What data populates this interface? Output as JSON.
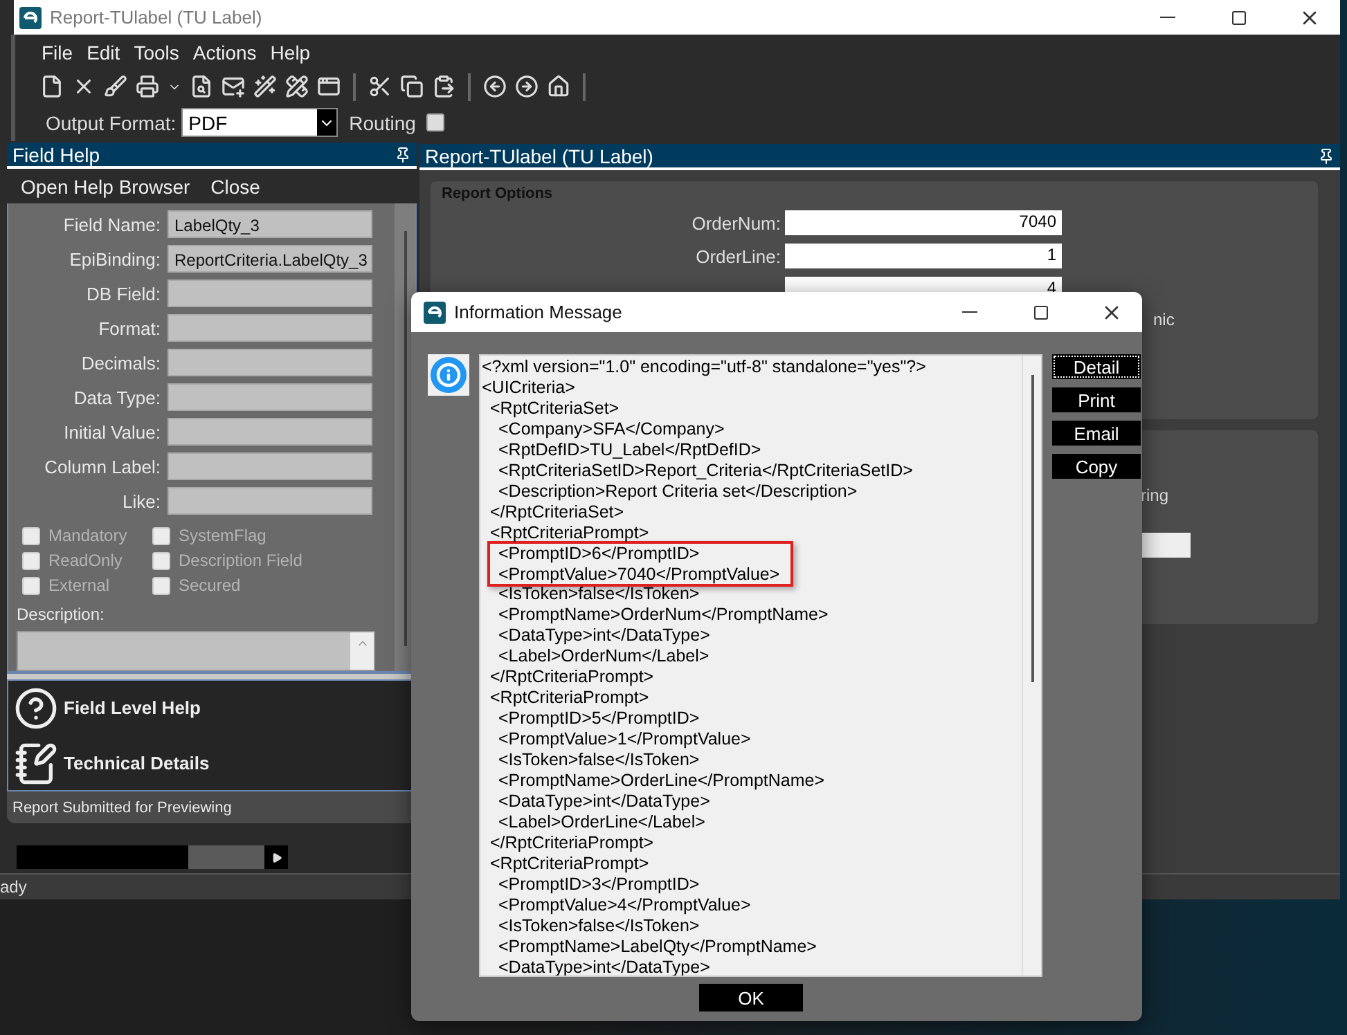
{
  "window": {
    "title": "Report-TUlabel (TU Label)"
  },
  "menu": [
    "File",
    "Edit",
    "Tools",
    "Actions",
    "Help"
  ],
  "output_format": {
    "label": "Output Format:",
    "value": "PDF"
  },
  "routing": {
    "label": "Routing",
    "checked": false
  },
  "field_help": {
    "title": "Field Help",
    "menu": [
      "Open Help Browser",
      "Close"
    ],
    "fields": [
      {
        "label": "Field Name:",
        "value": "LabelQty_3"
      },
      {
        "label": "EpiBinding:",
        "value": "ReportCriteria.LabelQty_3"
      },
      {
        "label": "DB Field:"
      },
      {
        "label": "Format:"
      },
      {
        "label": "Decimals:"
      },
      {
        "label": "Data Type:"
      },
      {
        "label": "Initial Value:"
      },
      {
        "label": "Column Label:"
      },
      {
        "label": "Like:"
      }
    ],
    "checkboxes": [
      {
        "label": "Mandatory",
        "checked": false,
        "disabled": true
      },
      {
        "label": "SystemFlag",
        "checked": false,
        "disabled": true
      },
      {
        "label": "ReadOnly",
        "checked": false,
        "disabled": true
      },
      {
        "label": "Description Field",
        "checked": false,
        "disabled": true
      },
      {
        "label": "External",
        "checked": false,
        "disabled": true
      },
      {
        "label": "Secured",
        "checked": false,
        "disabled": true
      }
    ],
    "description_label": "Description:",
    "links": [
      {
        "kind": "help",
        "label": "Field Level Help"
      },
      {
        "kind": "details",
        "label": "Technical Details"
      }
    ],
    "status": "Report Submitted for Previewing"
  },
  "report_panel": {
    "title": "Report-TUlabel (TU Label)",
    "group_title": "Report Options",
    "fields": [
      {
        "label": "OrderNum:",
        "value": "7040"
      },
      {
        "label": "OrderLine:",
        "value": "1"
      },
      {
        "value": "4"
      }
    ],
    "partial_label": "nic",
    "second_group_label": "ring"
  },
  "status_bar": "ady",
  "dialog": {
    "title": "Information Message",
    "lines": [
      {
        "text": "<?xml version=\"1.0\" encoding=\"utf-8\" standalone=\"yes\"?>",
        "highlighted": false
      },
      {
        "text": "<UICriteria>",
        "highlighted": false,
        "children": [
          {
            "text": "<RptCriteriaSet>",
            "highlighted": false,
            "children": [
              {
                "text": "<Company>SFA</Company>",
                "highlighted": false
              },
              {
                "text": "<RptDefID>TU_Label</RptDefID>",
                "highlighted": false
              },
              {
                "text": "<RptCriteriaSetID>Report_Criteria</RptCriteriaSetID>",
                "highlighted": false
              },
              {
                "text": "<Description>Report Criteria set</Description>",
                "highlighted": false
              }
            ]
          },
          {
            "text": "</RptCriteriaSet>",
            "highlighted": false
          },
          {
            "text": "<RptCriteriaPrompt>",
            "highlighted": false,
            "children": [
              {
                "text": "<PromptID>6</PromptID>",
                "highlighted": true
              },
              {
                "text": "<PromptValue>7040</PromptValue>",
                "highlighted": true
              },
              {
                "text": "<IsToken>false</IsToken>",
                "highlighted": false
              },
              {
                "text": "<PromptName>OrderNum</PromptName>",
                "highlighted": false
              },
              {
                "text": "<DataType>int</DataType>",
                "highlighted": false
              },
              {
                "text": "<Label>OrderNum</Label>",
                "highlighted": false
              }
            ]
          },
          {
            "text": "</RptCriteriaPrompt>",
            "highlighted": false
          },
          {
            "text": "<RptCriteriaPrompt>",
            "highlighted": false,
            "children": [
              {
                "text": "<PromptID>5</PromptID>",
                "highlighted": false
              },
              {
                "text": "<PromptValue>1</PromptValue>",
                "highlighted": false
              },
              {
                "text": "<IsToken>false</IsToken>",
                "highlighted": false
              },
              {
                "text": "<PromptName>OrderLine</PromptName>",
                "highlighted": false
              },
              {
                "text": "<DataType>int</DataType>",
                "highlighted": false
              },
              {
                "text": "<Label>OrderLine</Label>",
                "highlighted": false
              }
            ]
          },
          {
            "text": "</RptCriteriaPrompt>",
            "highlighted": false
          },
          {
            "text": "<RptCriteriaPrompt>",
            "highlighted": false,
            "children": [
              {
                "text": "<PromptID>3</PromptID>",
                "highlighted": false
              },
              {
                "text": "<PromptValue>4</PromptValue>",
                "highlighted": false
              },
              {
                "text": "<IsToken>false</IsToken>",
                "highlighted": false
              },
              {
                "text": "<PromptName>LabelQty</PromptName>",
                "highlighted": false
              },
              {
                "text": "<DataType>int</DataType>",
                "highlighted": false
              }
            ]
          }
        ]
      }
    ],
    "buttons": [
      {
        "label": "Detail",
        "focused": true
      },
      {
        "label": "Print",
        "focused": false
      },
      {
        "label": "Email",
        "focused": false
      },
      {
        "label": "Copy",
        "focused": false
      }
    ],
    "ok": "OK"
  }
}
